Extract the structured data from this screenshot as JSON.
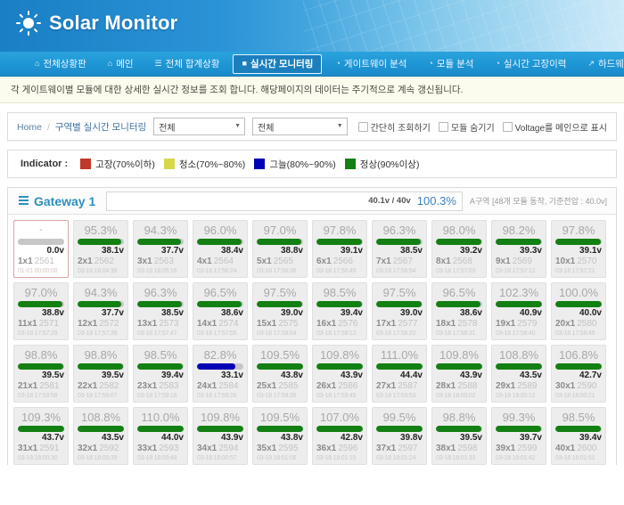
{
  "app": {
    "title": "Solar Monitor",
    "logo_icon": "sun-icon"
  },
  "nav": {
    "items": [
      {
        "label": "전체상황판",
        "icon": "home-icon",
        "active": false
      },
      {
        "label": "메인",
        "icon": "home-icon",
        "active": false
      },
      {
        "label": "전체 합계상황",
        "icon": "document-icon",
        "active": false
      },
      {
        "label": "실시간 모니터링",
        "icon": "monitor-icon",
        "active": true
      },
      {
        "label": "게이트웨이 분석",
        "icon": "chart-icon",
        "active": false
      },
      {
        "label": "모듈 분석",
        "icon": "chart-icon",
        "active": false
      },
      {
        "label": "실시간 고장이력",
        "icon": "chart-icon",
        "active": false
      },
      {
        "label": "하드웨어 오류분석",
        "icon": "external-icon",
        "active": false
      }
    ]
  },
  "notice": {
    "text": "각 게이트웨이별 모듈에 대한 상세한 실시간 정보를 조회 합니다. 해당페이지의 데이터는 주기적으로 계속 갱신됩니다."
  },
  "breadcrumb": {
    "home": "Home",
    "separator": "/",
    "current": "구역별 실시간 모니터링"
  },
  "filters": {
    "select_area": {
      "value": "전체",
      "caret": "▼"
    },
    "select_gateway": {
      "value": "전체",
      "caret": "▼"
    },
    "checkboxes": [
      {
        "label": "간단히 조회하기",
        "checked": false
      },
      {
        "label": "모듈 숨기기",
        "checked": false
      },
      {
        "label": "Voltage를 메인으로 표시",
        "checked": false
      }
    ]
  },
  "indicator": {
    "label": "Indicator :",
    "items": [
      {
        "label": "고장(70%이하)",
        "color": "#c0392b"
      },
      {
        "label": "청소(70%~80%)",
        "color": "#d6d84a"
      },
      {
        "label": "그늘(80%~90%)",
        "color": "#0000b4"
      },
      {
        "label": "정상(90%이상)",
        "color": "#128012"
      }
    ]
  },
  "gateway": {
    "title": "Gateway 1",
    "icon": "list-icon",
    "voltage_label": "40.1v / 40v",
    "percent": "100.3%",
    "note": "A구역 [48개 모듈 동작, 기준전압 : 40.0v]"
  },
  "modules": [
    {
      "pct": "-",
      "volt": "0.0v",
      "id": "1x1",
      "serial": "2561",
      "ts": "01-01 00:00:00",
      "bar": 100,
      "color": "#c7c7c7",
      "state": "alert"
    },
    {
      "pct": "95.3%",
      "volt": "38.1v",
      "id": "2x1",
      "serial": "2562",
      "ts": "03-18 18:04:39",
      "bar": 95,
      "color": "#128012",
      "state": "ok"
    },
    {
      "pct": "94.3%",
      "volt": "37.7v",
      "id": "3x1",
      "serial": "2563",
      "ts": "03-18 18:05:16",
      "bar": 94,
      "color": "#128012",
      "state": "ok"
    },
    {
      "pct": "96.0%",
      "volt": "38.4v",
      "id": "4x1",
      "serial": "2564",
      "ts": "03-18 17:56:24",
      "bar": 96,
      "color": "#128012",
      "state": "ok"
    },
    {
      "pct": "97.0%",
      "volt": "38.8v",
      "id": "5x1",
      "serial": "2565",
      "ts": "03-18 17:56:36",
      "bar": 97,
      "color": "#128012",
      "state": "ok"
    },
    {
      "pct": "97.8%",
      "volt": "39.1v",
      "id": "6x1",
      "serial": "2566",
      "ts": "03-18 17:56:45",
      "bar": 98,
      "color": "#128012",
      "state": "ok"
    },
    {
      "pct": "96.3%",
      "volt": "38.5v",
      "id": "7x1",
      "serial": "2567",
      "ts": "03-18 17:56:54",
      "bar": 96,
      "color": "#128012",
      "state": "ok"
    },
    {
      "pct": "98.0%",
      "volt": "39.2v",
      "id": "8x1",
      "serial": "2568",
      "ts": "03-18 17:57:03",
      "bar": 98,
      "color": "#128012",
      "state": "ok"
    },
    {
      "pct": "98.2%",
      "volt": "39.3v",
      "id": "9x1",
      "serial": "2569",
      "ts": "03-18 17:57:12",
      "bar": 98,
      "color": "#128012",
      "state": "ok"
    },
    {
      "pct": "97.8%",
      "volt": "39.1v",
      "id": "10x1",
      "serial": "2570",
      "ts": "03-18 17:57:21",
      "bar": 98,
      "color": "#128012",
      "state": "ok"
    },
    {
      "pct": "97.0%",
      "volt": "38.8v",
      "id": "11x1",
      "serial": "2571",
      "ts": "03-18 17:57:29",
      "bar": 97,
      "color": "#128012",
      "state": "ok"
    },
    {
      "pct": "94.3%",
      "volt": "37.7v",
      "id": "12x1",
      "serial": "2572",
      "ts": "03-18 17:57:38",
      "bar": 94,
      "color": "#128012",
      "state": "ok"
    },
    {
      "pct": "96.3%",
      "volt": "38.5v",
      "id": "13x1",
      "serial": "2573",
      "ts": "03-18 17:57:47",
      "bar": 96,
      "color": "#128012",
      "state": "ok"
    },
    {
      "pct": "96.5%",
      "volt": "38.6v",
      "id": "14x1",
      "serial": "2574",
      "ts": "03-18 17:57:55",
      "bar": 97,
      "color": "#128012",
      "state": "ok"
    },
    {
      "pct": "97.5%",
      "volt": "39.0v",
      "id": "15x1",
      "serial": "2575",
      "ts": "03-18 17:58:04",
      "bar": 98,
      "color": "#128012",
      "state": "ok"
    },
    {
      "pct": "98.5%",
      "volt": "39.4v",
      "id": "16x1",
      "serial": "2576",
      "ts": "03-18 17:58:13",
      "bar": 99,
      "color": "#128012",
      "state": "ok"
    },
    {
      "pct": "97.5%",
      "volt": "39.0v",
      "id": "17x1",
      "serial": "2577",
      "ts": "03-18 17:58:22",
      "bar": 98,
      "color": "#128012",
      "state": "ok"
    },
    {
      "pct": "96.5%",
      "volt": "38.6v",
      "id": "18x1",
      "serial": "2578",
      "ts": "03-18 17:58:31",
      "bar": 97,
      "color": "#128012",
      "state": "ok"
    },
    {
      "pct": "102.3%",
      "volt": "40.9v",
      "id": "19x1",
      "serial": "2579",
      "ts": "03-18 17:58:40",
      "bar": 100,
      "color": "#128012",
      "state": "ok"
    },
    {
      "pct": "100.0%",
      "volt": "40.0v",
      "id": "20x1",
      "serial": "2580",
      "ts": "03-18 17:58:49",
      "bar": 100,
      "color": "#128012",
      "state": "ok"
    },
    {
      "pct": "98.8%",
      "volt": "39.5v",
      "id": "21x1",
      "serial": "2581",
      "ts": "03-18 17:58:58",
      "bar": 99,
      "color": "#128012",
      "state": "ok"
    },
    {
      "pct": "98.8%",
      "volt": "39.5v",
      "id": "22x1",
      "serial": "2582",
      "ts": "03-18 17:59:07",
      "bar": 99,
      "color": "#128012",
      "state": "ok"
    },
    {
      "pct": "98.5%",
      "volt": "39.4v",
      "id": "23x1",
      "serial": "2583",
      "ts": "03-18 17:59:16",
      "bar": 99,
      "color": "#128012",
      "state": "ok"
    },
    {
      "pct": "82.8%",
      "volt": "33.1v",
      "id": "24x1",
      "serial": "2584",
      "ts": "03-18 17:59:26",
      "bar": 83,
      "color": "#0000b4",
      "state": "shade"
    },
    {
      "pct": "109.5%",
      "volt": "43.8v",
      "id": "25x1",
      "serial": "2585",
      "ts": "03-18 17:59:35",
      "bar": 100,
      "color": "#128012",
      "state": "ok"
    },
    {
      "pct": "109.8%",
      "volt": "43.9v",
      "id": "26x1",
      "serial": "2586",
      "ts": "03-18 17:59:45",
      "bar": 100,
      "color": "#128012",
      "state": "ok"
    },
    {
      "pct": "111.0%",
      "volt": "44.4v",
      "id": "27x1",
      "serial": "2587",
      "ts": "03-18 17:59:53",
      "bar": 100,
      "color": "#128012",
      "state": "ok"
    },
    {
      "pct": "109.8%",
      "volt": "43.9v",
      "id": "28x1",
      "serial": "2588",
      "ts": "03-18 18:00:02",
      "bar": 100,
      "color": "#128012",
      "state": "ok"
    },
    {
      "pct": "108.8%",
      "volt": "43.5v",
      "id": "29x1",
      "serial": "2589",
      "ts": "03-18 18:00:12",
      "bar": 100,
      "color": "#128012",
      "state": "ok"
    },
    {
      "pct": "106.8%",
      "volt": "42.7v",
      "id": "30x1",
      "serial": "2590",
      "ts": "03-18 18:00:21",
      "bar": 100,
      "color": "#128012",
      "state": "ok"
    },
    {
      "pct": "109.3%",
      "volt": "43.7v",
      "id": "31x1",
      "serial": "2591",
      "ts": "03-18 18:00:30",
      "bar": 100,
      "color": "#128012",
      "state": "ok"
    },
    {
      "pct": "108.8%",
      "volt": "43.5v",
      "id": "32x1",
      "serial": "2592",
      "ts": "03-18 18:00:39",
      "bar": 100,
      "color": "#128012",
      "state": "ok"
    },
    {
      "pct": "110.0%",
      "volt": "44.0v",
      "id": "33x1",
      "serial": "2593",
      "ts": "03-18 18:00:48",
      "bar": 100,
      "color": "#128012",
      "state": "ok"
    },
    {
      "pct": "109.8%",
      "volt": "43.9v",
      "id": "34x1",
      "serial": "2594",
      "ts": "03-18 18:00:57",
      "bar": 100,
      "color": "#128012",
      "state": "ok"
    },
    {
      "pct": "109.5%",
      "volt": "43.8v",
      "id": "35x1",
      "serial": "2595",
      "ts": "03-18 18:01:06",
      "bar": 100,
      "color": "#128012",
      "state": "ok"
    },
    {
      "pct": "107.0%",
      "volt": "42.8v",
      "id": "36x1",
      "serial": "2596",
      "ts": "03-18 18:01:15",
      "bar": 100,
      "color": "#128012",
      "state": "ok"
    },
    {
      "pct": "99.5%",
      "volt": "39.8v",
      "id": "37x1",
      "serial": "2597",
      "ts": "03-18 18:01:24",
      "bar": 100,
      "color": "#128012",
      "state": "ok"
    },
    {
      "pct": "98.8%",
      "volt": "39.5v",
      "id": "38x1",
      "serial": "2598",
      "ts": "03-18 18:01:33",
      "bar": 99,
      "color": "#128012",
      "state": "ok"
    },
    {
      "pct": "99.3%",
      "volt": "39.7v",
      "id": "39x1",
      "serial": "2599",
      "ts": "03-18 18:01:42",
      "bar": 99,
      "color": "#128012",
      "state": "ok"
    },
    {
      "pct": "98.5%",
      "volt": "39.4v",
      "id": "40x1",
      "serial": "2600",
      "ts": "03-18 18:01:51",
      "bar": 99,
      "color": "#128012",
      "state": "ok"
    }
  ],
  "partial_row_count": 10
}
